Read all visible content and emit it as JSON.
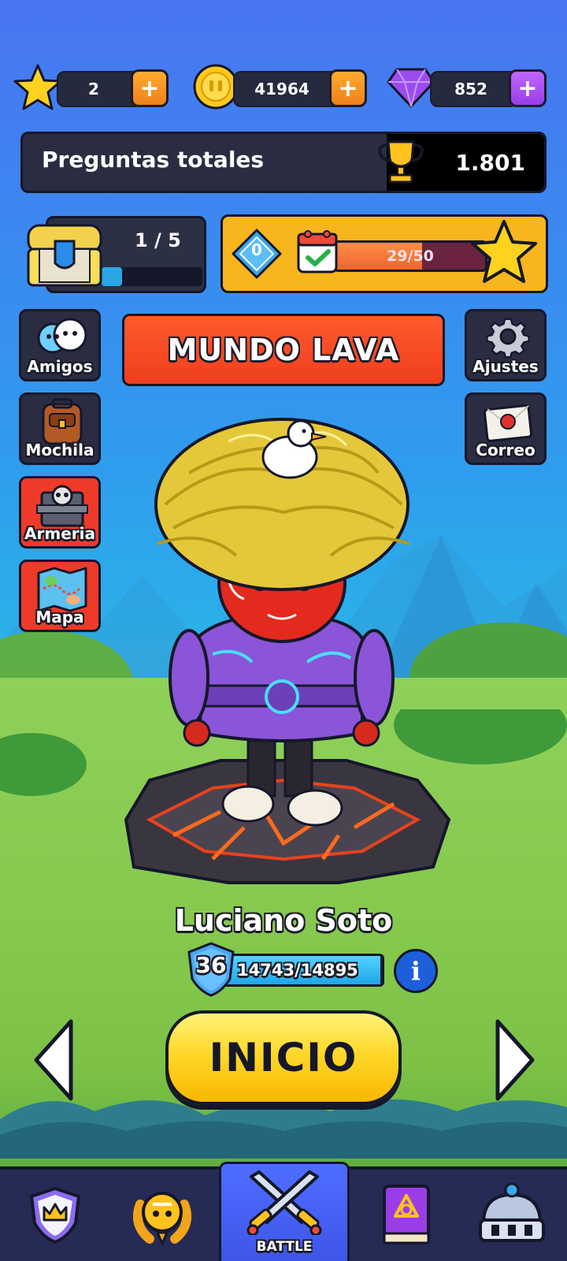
{
  "currencies": {
    "stars": {
      "value": "2",
      "icon": "star-icon"
    },
    "coins": {
      "value": "41964",
      "icon": "coin-icon"
    },
    "gems": {
      "value": "852",
      "icon": "gem-icon"
    },
    "plus": "+"
  },
  "total_questions": {
    "label": "Preguntas totales",
    "value": "1.801",
    "icon": "trophy-icon"
  },
  "chest": {
    "progress_text": "1 / 5",
    "progress_fraction": 0.2,
    "icon": "chest-icon"
  },
  "daily": {
    "gem_count": "0",
    "progress_text": "29/50",
    "progress_fraction": 0.58,
    "icons": [
      "diamond-icon",
      "calendar-check-icon",
      "star-icon"
    ]
  },
  "left_menu": [
    {
      "label": "Amigos",
      "icon": "friends-icon"
    },
    {
      "label": "Mochila",
      "icon": "backpack-icon"
    },
    {
      "label": "Armeria",
      "icon": "armory-icon"
    },
    {
      "label": "Mapa",
      "icon": "map-icon"
    }
  ],
  "right_menu": [
    {
      "label": "Ajustes",
      "icon": "gear-icon"
    },
    {
      "label": "Correo",
      "icon": "mail-icon"
    }
  ],
  "world": {
    "label": "MUNDO LAVA"
  },
  "player": {
    "name": "Luciano Soto",
    "level": "36",
    "xp_text": "14743/14895",
    "xp_fraction": 0.99,
    "info": "i"
  },
  "start_button": "INICIO",
  "nav": {
    "battle_label": "BATTLE",
    "items": [
      "crown-shield-icon",
      "laurel-medal-icon",
      "crossed-swords-icon",
      "spellbook-icon",
      "shop-dome-icon"
    ]
  },
  "colors": {
    "sky": "#3d86f0",
    "grass": "#86c94e",
    "accent_orange": "#f0801a",
    "accent_purple": "#9a3de8",
    "world_red": "#ef3e1e",
    "start_yellow": "#ffd82a",
    "xp_blue": "#1fa6e6"
  }
}
